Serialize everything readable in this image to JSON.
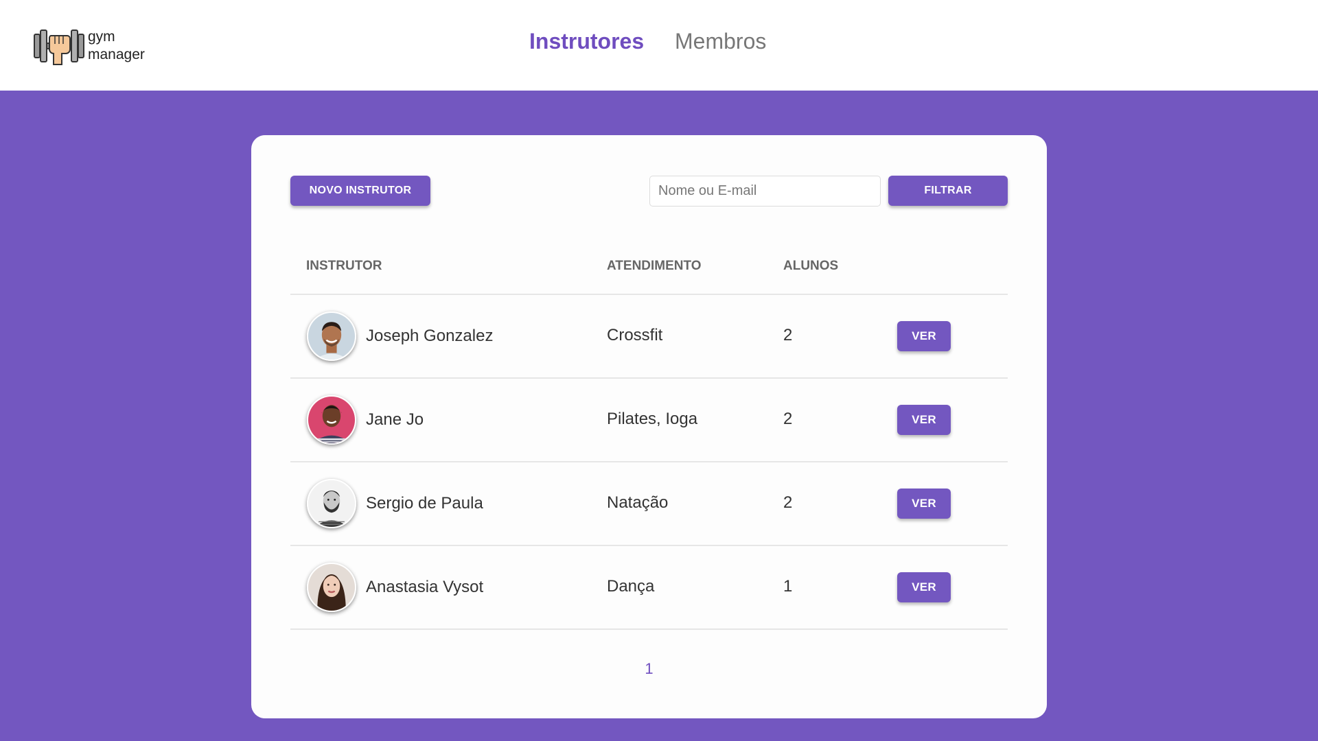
{
  "brand": {
    "logo_line1": "gym",
    "logo_line2": "manager",
    "accent_color": "#7357c0"
  },
  "nav": {
    "items": [
      {
        "label": "Instrutores",
        "active": true
      },
      {
        "label": "Membros",
        "active": false
      }
    ]
  },
  "toolbar": {
    "new_button_label": "NOVO INSTRUTOR",
    "search_placeholder": "Nome ou E-mail",
    "search_value": "",
    "filter_button_label": "FILTRAR"
  },
  "table": {
    "columns": [
      "INSTRUTOR",
      "ATENDIMENTO",
      "ALUNOS"
    ],
    "rows": [
      {
        "name": "Joseph Gonzalez",
        "services": "Crossfit",
        "students": "2",
        "action_label": "VER",
        "avatar": "man-smiling"
      },
      {
        "name": "Jane Jo",
        "services": "Pilates, Ioga",
        "students": "2",
        "action_label": "VER",
        "avatar": "woman-smiling-pink-background"
      },
      {
        "name": "Sergio de Paula",
        "services": "Natação",
        "students": "2",
        "action_label": "VER",
        "avatar": "bearded-man-grayscale"
      },
      {
        "name": "Anastasia Vysot",
        "services": "Dança",
        "students": "1",
        "action_label": "VER",
        "avatar": "woman-dark-hair"
      }
    ]
  },
  "pagination": {
    "current_page": "1"
  }
}
